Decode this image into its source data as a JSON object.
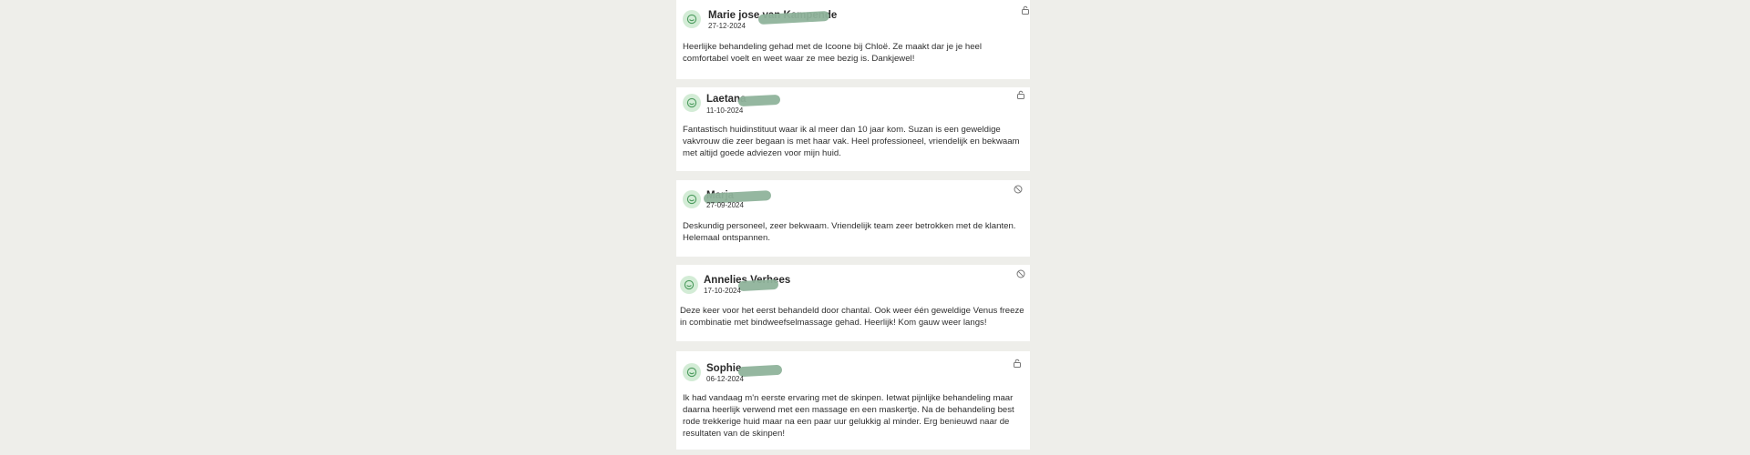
{
  "reviews": [
    {
      "name": "Marie jose van Kampende",
      "date": "27-12-2024",
      "text": "Heerlijke behandeling gehad met de Icoone bij Chloë. Ze maakt dar je je heel comfortabel voelt en weet waar ze mee bezig is. Dankjewel!",
      "action_icon": "lock-open-icon"
    },
    {
      "name": "Laetana",
      "date": "11-10-2024",
      "text": "Fantastisch huidinstituut waar ik al meer dan 10 jaar kom. Suzan is een geweldige vakvrouw die zeer begaan is met haar vak. Heel professioneel, vriendelijk en bekwaam met altijd goede adviezen voor mijn huid.",
      "action_icon": "lock-open-icon"
    },
    {
      "name": "Marja",
      "date": "27-09-2024",
      "text": "Deskundig personeel, zeer bekwaam. Vriendelijk team zeer betrokken met de klanten. Helemaal ontspannen.",
      "action_icon": "blocked-icon"
    },
    {
      "name": "Annelies Verhees",
      "date": "17-10-2024",
      "text": "Deze keer voor het eerst behandeld door chantal. Ook weer één geweldige Venus freeze in combinatie met bindweefselmassage gehad. Heerlijk! Kom gauw weer langs!",
      "action_icon": "blocked-icon"
    },
    {
      "name": "Sophie",
      "date": "06-12-2024",
      "text": "Ik had vandaag m'n eerste ervaring met de skinpen. Ietwat pijnlijke behandeling maar daarna heerlijk verwend met een massage en een maskertje. Na de behandeling best rode trekkerige huid maar na een paar uur gelukkig al minder. Erg benieuwd naar de resultaten van de skinpen!",
      "action_icon": "lock-open-icon"
    }
  ],
  "colors": {
    "page_background": "#eeeeea",
    "card_background": "#ffffff",
    "avatar_background": "#d3ecd6",
    "avatar_stroke": "#4a9a5c",
    "redaction": "#8fb39b"
  }
}
